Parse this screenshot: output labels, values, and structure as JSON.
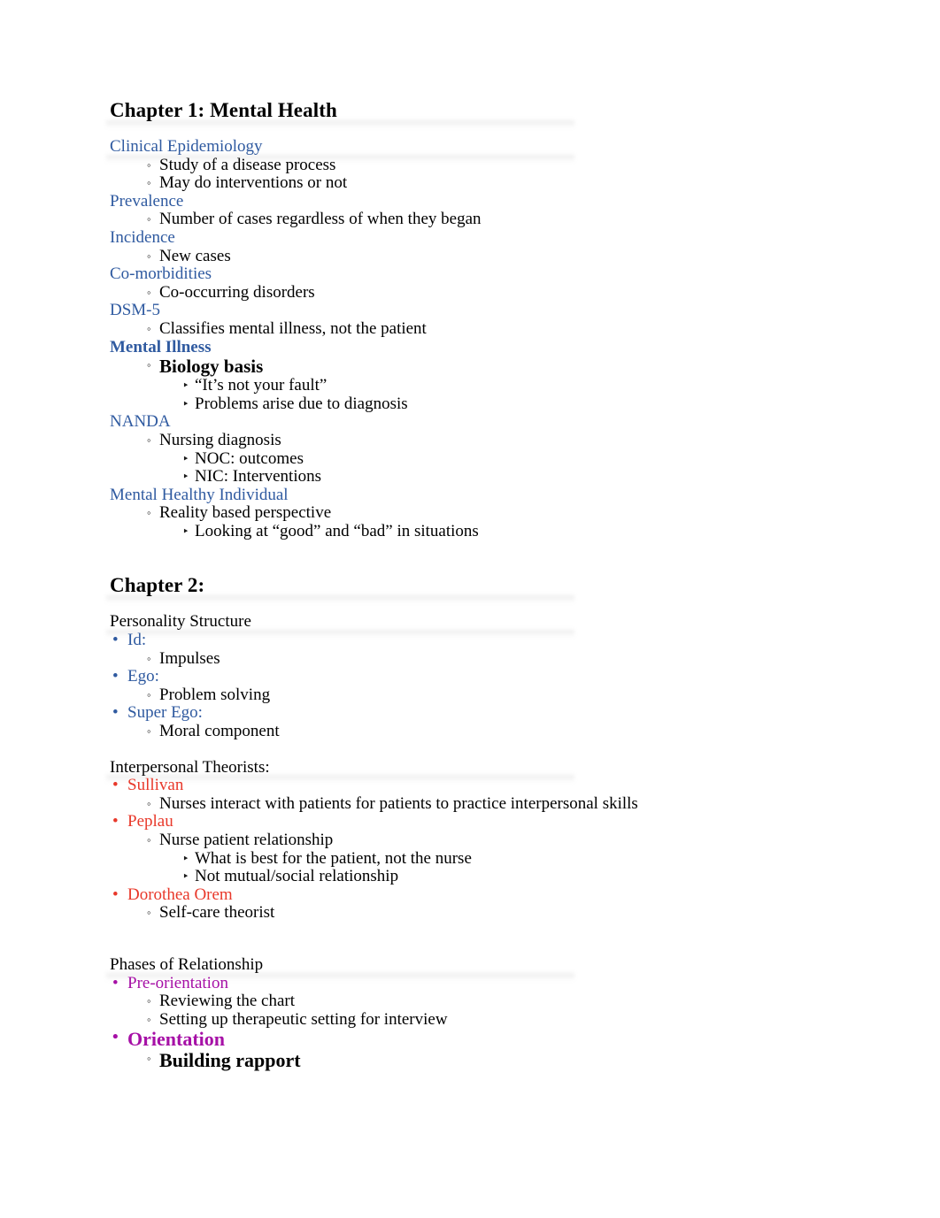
{
  "colors": {
    "blue": "#2f5aa0",
    "red": "#e8382a",
    "magenta": "#a610a6",
    "black": "#000000"
  },
  "markers": {
    "bullet": "•",
    "circle": "◦",
    "triangle": "‣"
  },
  "chapter1": {
    "heading": "Chapter 1: Mental Health",
    "entries": [
      {
        "label": "Clinical Epidemiology"
      },
      {
        "label": "Study of a disease process"
      },
      {
        "label": "May do interventions or not"
      },
      {
        "label": "Prevalence"
      },
      {
        "label": "Number of cases regardless of when they began"
      },
      {
        "label": "Incidence"
      },
      {
        "label": "New cases"
      },
      {
        "label": "Co-morbidities"
      },
      {
        "label": "Co-occurring disorders"
      },
      {
        "label": "DSM-5"
      },
      {
        "label": "Classifies mental illness, not the patient"
      },
      {
        "label": "Mental Illness"
      },
      {
        "label": "Biology basis"
      },
      {
        "label": "“It’s not your fault”"
      },
      {
        "label": "Problems arise due to diagnosis"
      },
      {
        "label": "NANDA"
      },
      {
        "label": "Nursing diagnosis"
      },
      {
        "label": "NOC: outcomes"
      },
      {
        "label": "NIC: Interventions"
      },
      {
        "label": "Mental Healthy Individual"
      },
      {
        "label": "Reality based perspective"
      },
      {
        "label": "Looking at “good” and “bad” in situations"
      }
    ]
  },
  "chapter2": {
    "heading": "Chapter 2:",
    "section1": {
      "title": "Personality Structure",
      "entries": [
        {
          "label": "Id:"
        },
        {
          "label": "Impulses"
        },
        {
          "label": "Ego:"
        },
        {
          "label": "Problem solving"
        },
        {
          "label": "Super Ego:"
        },
        {
          "label": "Moral component"
        }
      ]
    },
    "section2": {
      "title": "Interpersonal Theorists:",
      "entries": [
        {
          "label": "Sullivan"
        },
        {
          "label": "Nurses interact with patients for patients to practice interpersonal skills"
        },
        {
          "label": "Peplau"
        },
        {
          "label": "Nurse patient relationship"
        },
        {
          "label": "What is best for the patient, not the nurse"
        },
        {
          "label": "Not mutual/social relationship"
        },
        {
          "label": "Dorothea Orem"
        },
        {
          "label": "Self-care theorist"
        }
      ]
    },
    "section3": {
      "title": "Phases of Relationship",
      "entries": [
        {
          "label": "Pre-orientation"
        },
        {
          "label": "Reviewing the chart"
        },
        {
          "label": "Setting up therapeutic setting for interview"
        },
        {
          "label": "Orientation"
        },
        {
          "label": "Building rapport"
        }
      ]
    }
  }
}
